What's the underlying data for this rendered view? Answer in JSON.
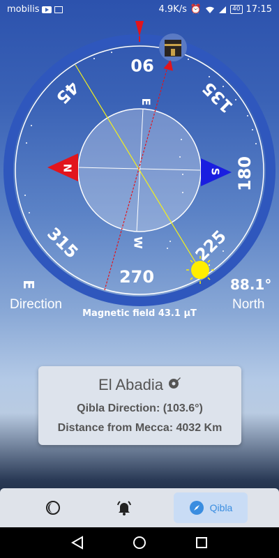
{
  "status_bar": {
    "carrier": "mobilis",
    "network_speed": "4.9K/s",
    "battery": "40",
    "time": "17:15"
  },
  "compass": {
    "cardinal_letters": {
      "north": "N",
      "east": "E",
      "south": "S",
      "west": "W"
    },
    "degree_labels": [
      "90",
      "135",
      "180",
      "225",
      "270",
      "315",
      "45"
    ],
    "heading_letter": "E",
    "heading_caption": "Direction",
    "heading_degrees": "88.1°",
    "heading_direction": "North",
    "magnetic_field": "Magnetic field 43.1 μT"
  },
  "qibla_card": {
    "city": "El Abadia",
    "qibla_direction": "Qibla Direction: (103.6°)",
    "distance": "Distance from Mecca: 4032 Km"
  },
  "bottom_nav": {
    "items": [
      {
        "icon": "prayer-times-icon",
        "label": ""
      },
      {
        "icon": "alarm-bell-icon",
        "label": ""
      },
      {
        "icon": "compass-icon",
        "label": "Qibla"
      }
    ],
    "active_color": "#3a8de0"
  }
}
